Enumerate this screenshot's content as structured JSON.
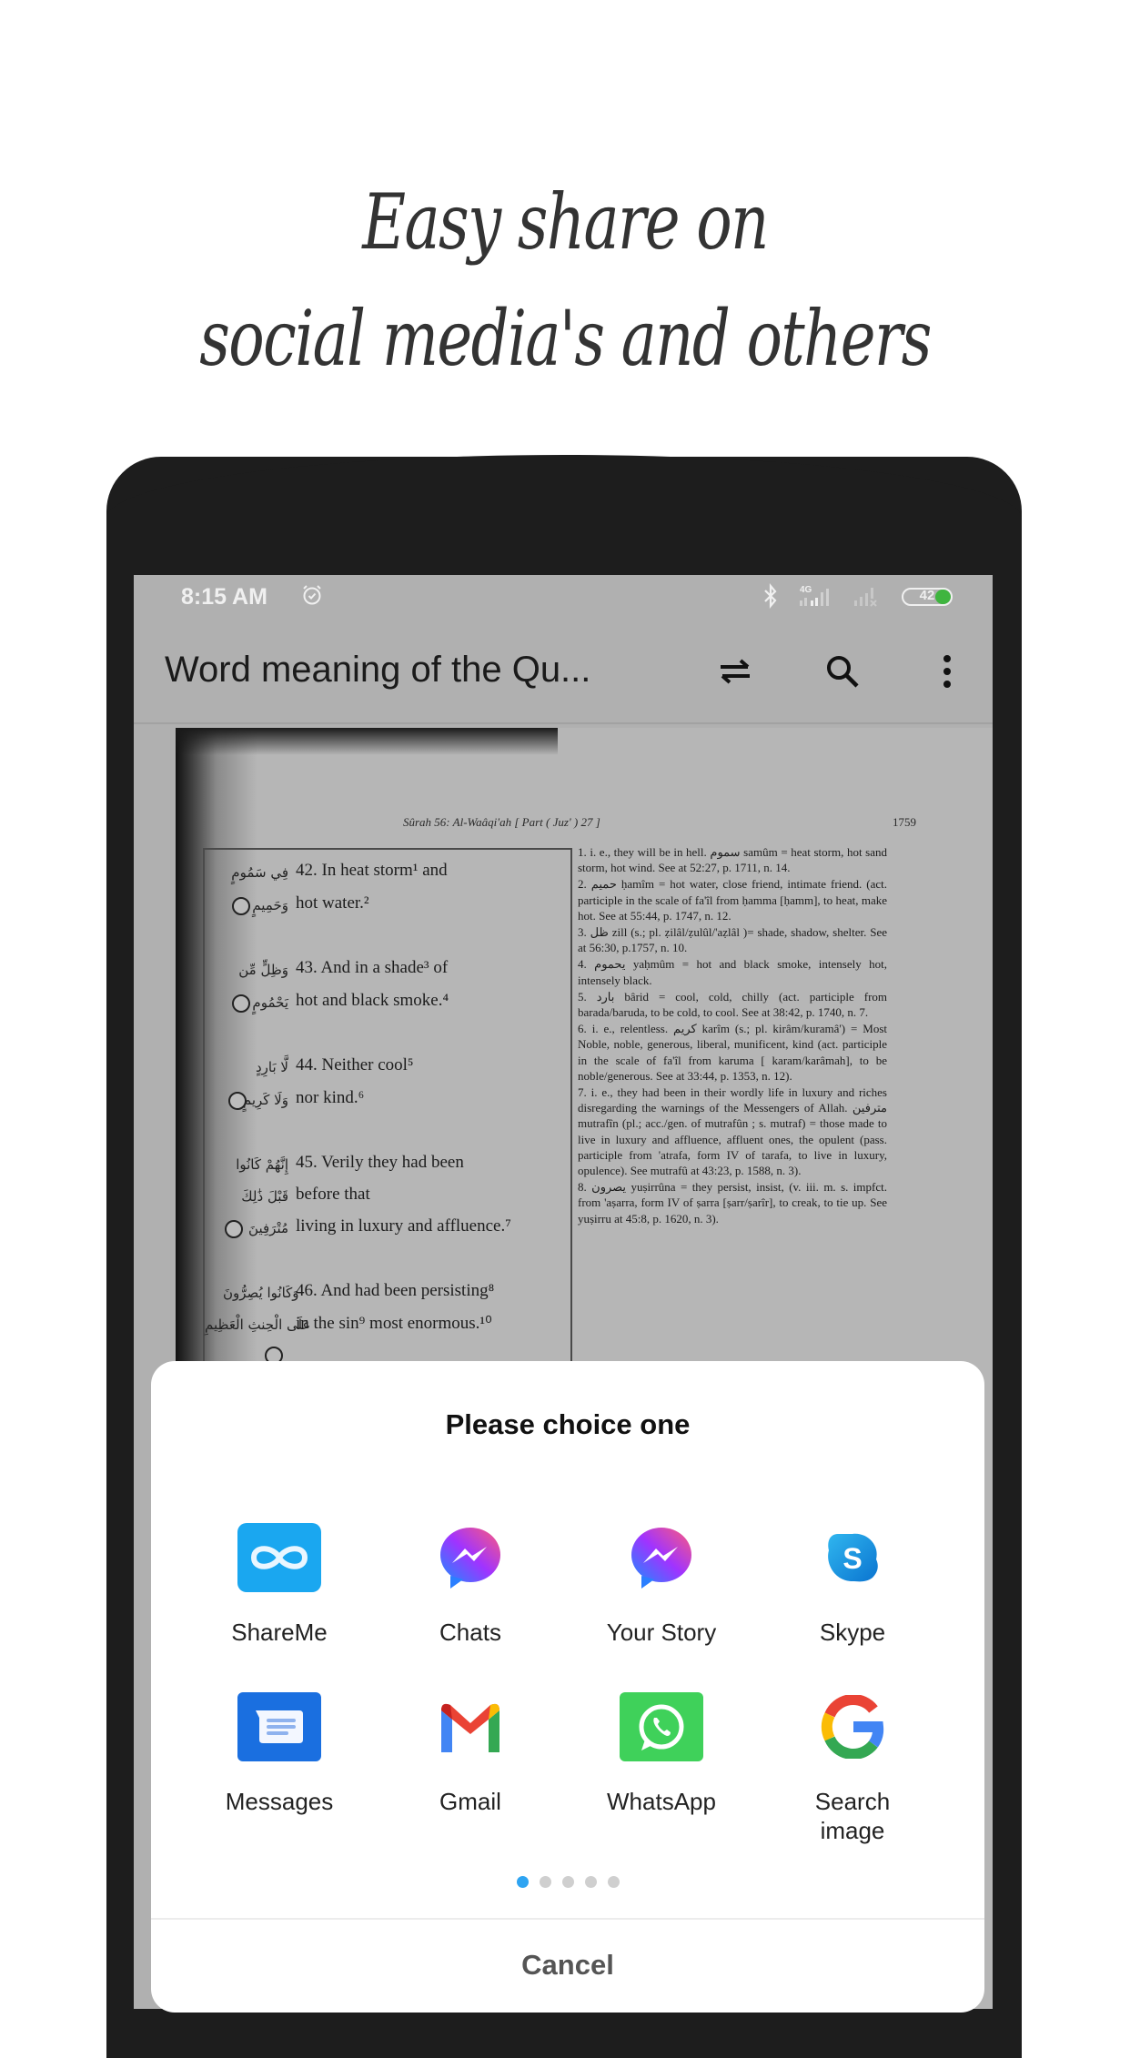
{
  "headline": {
    "line1": "Easy share on",
    "line2": "social media's and others"
  },
  "statusbar": {
    "time": "8:15 AM",
    "network": "4G",
    "battery": "42",
    "battery_level_percent": 42,
    "icons": [
      "alarm-icon",
      "bluetooth-icon",
      "signal-4g-icon",
      "signal-no-sim-icon",
      "battery-icon"
    ]
  },
  "appbar": {
    "title": "Word meaning of the Qu...",
    "actions": [
      "swap-icon",
      "search-icon",
      "more-vert-icon"
    ]
  },
  "page": {
    "running_head": "Sûrah 56: Al-Waâqi'ah [ Part ( Juz' ) 27 ]",
    "page_number": "1759",
    "verses": [
      {
        "arabic": "فِي سَمُومٍ",
        "text": "42. In heat storm¹ and"
      },
      {
        "arabic": "وَحَمِيمٍ",
        "text": "hot water.²"
      },
      {
        "arabic": "وَظِلٍّ مِّن",
        "text": "43. And in a shade³ of"
      },
      {
        "arabic": "يَحْمُومٍ",
        "text": "hot and black smoke.⁴"
      },
      {
        "arabic": "لَّا بَارِدٍ",
        "text": "44. Neither cool⁵"
      },
      {
        "arabic": "وَلَا كَرِيمٍ",
        "text": "nor kind.⁶"
      },
      {
        "arabic": "إِنَّهُمْ كَانُوا",
        "text": "45. Verily they had been"
      },
      {
        "arabic": "قَبْلَ ذَٰلِكَ",
        "text": "before that"
      },
      {
        "arabic": "مُتْرَفِينَ",
        "text": "living in luxury and affluence.⁷"
      },
      {
        "arabic": "وَكَانُوا يُصِرُّونَ",
        "text": "46. And had been persisting⁸"
      },
      {
        "arabic": "عَلَى الْحِنثِ الْعَظِيمِ",
        "text": "in the sin⁹ most enormous.¹⁰"
      }
    ],
    "notes": [
      "1. i. e., they will be in hell. سموم samûm = heat storm, hot sand storm, hot wind. See at 52:27, p. 1711, n. 14.",
      "2. حميم ḥamîm = hot water, close friend, intimate friend. (act. participle in the scale of fa'îl from ḥamma [ḥamm], to heat, make hot. See at 55:44, p. 1747, n. 12.",
      "3. ظل zill (s.; pl. ẓilâl/ẓulûl/'aẓlâl )= shade, shadow, shelter. See at 56:30, p.1757, n. 10.",
      "4. يحموم yaḥmûm = hot and black smoke, intensely hot, intensely black.",
      "5. بارد bârid = cool, cold, chilly (act. participle from barada/baruda, to be cold, to cool. See at 38:42, p. 1740, n. 7.",
      "6. i. e., relentless. كريم karîm (s.; pl. kirâm/kuramâ') = Most Noble, noble, generous, liberal, munificent, kind (act. participle in the scale of fa'îl from karuma [ karam/karâmah], to be noble/generous. See at 33:44, p. 1353, n. 12).",
      "7. i. e., they had been in their wordly life in luxury and riches disregarding the warnings of the Messengers of Allah. مترفين mutrafîn (pl.; acc./gen. of mutrafûn ; s. mutraf) = those made to live in luxury and affluence, affluent ones, the opulent (pass. participle from 'atrafa, form IV of tarafa, to live in luxury, opulence). See mutrafû at 43:23, p. 1588, n. 3).",
      "8. يصرون yuṣirrûna = they persist, insist, (v. iii. m. s. impfct. from 'aṣarra, form IV of ṣarra [ṣarr/ṣarîr], to creak, to tie up. See yuṣirru at 45:8, p. 1620, n. 3)."
    ]
  },
  "dialog": {
    "title": "Please choice one",
    "apps": [
      {
        "label": "ShareMe",
        "icon": "shareme-icon"
      },
      {
        "label": "Chats",
        "icon": "messenger-icon"
      },
      {
        "label": "Your Story",
        "icon": "messenger-icon"
      },
      {
        "label": "Skype",
        "icon": "skype-icon"
      },
      {
        "label": "Messages",
        "icon": "messages-icon"
      },
      {
        "label": "Gmail",
        "icon": "gmail-icon"
      },
      {
        "label": "WhatsApp",
        "icon": "whatsapp-icon"
      },
      {
        "label": "Search image",
        "icon": "google-icon"
      }
    ],
    "pager": {
      "pages": 5,
      "current": 1
    },
    "cancel_label": "Cancel"
  },
  "colors": {
    "accent": "#2ea4f2",
    "phone_frame": "#1d1d1d",
    "dim_overlay": "#b0b0b0",
    "battery_green": "#3fb53f"
  }
}
